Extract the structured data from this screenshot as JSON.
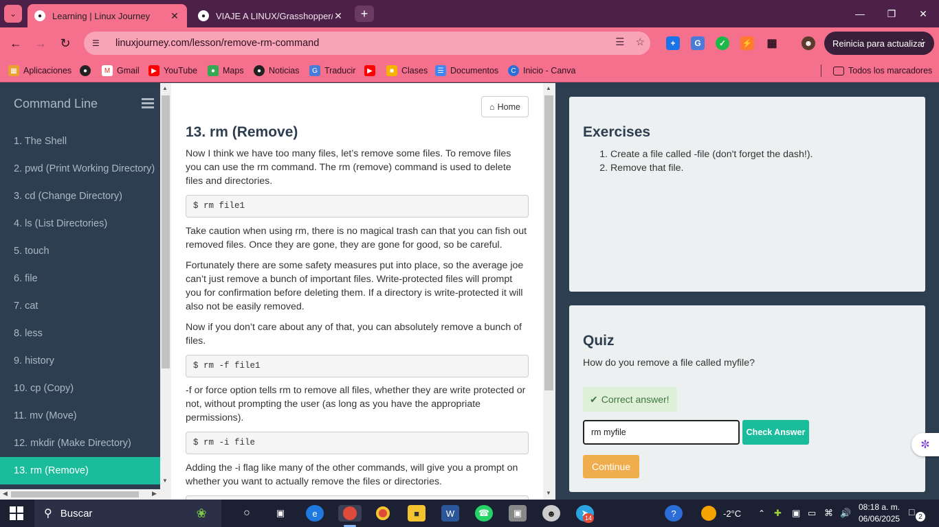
{
  "browser": {
    "tabs": [
      {
        "title": "Learning | Linux Journey",
        "active": true,
        "icon": "penguin-icon"
      },
      {
        "title": "VIAJE A LINUX/Grasshopper/Linux",
        "active": false,
        "icon": "github-icon"
      }
    ],
    "url": "linuxjourney.com/lesson/remove-rm-command",
    "update_button": "Reinicia para actualizar",
    "bookmarks": [
      {
        "label": "Aplicaciones",
        "icon": "apps-grid-icon"
      },
      {
        "label": "",
        "icon": "globe-icon"
      },
      {
        "label": "Gmail",
        "icon": "gmail-icon"
      },
      {
        "label": "YouTube",
        "icon": "youtube-icon"
      },
      {
        "label": "Maps",
        "icon": "maps-icon"
      },
      {
        "label": "Noticias",
        "icon": "news-icon"
      },
      {
        "label": "Traducir",
        "icon": "translate-icon"
      },
      {
        "label": "",
        "icon": "youtube-icon"
      },
      {
        "label": "Clases",
        "icon": "classroom-icon"
      },
      {
        "label": "Documentos",
        "icon": "docs-icon"
      },
      {
        "label": "Inicio - Canva",
        "icon": "canva-icon"
      }
    ],
    "all_bookmarks": "Todos los marcadores",
    "colors": {
      "tabbar": "#4c2048",
      "toolbar": "#f4708c"
    }
  },
  "sidebar": {
    "title": "Command Line",
    "items": [
      "1. The Shell",
      "2. pwd (Print Working Directory)",
      "3. cd (Change Directory)",
      "4. ls (List Directories)",
      "5. touch",
      "6. file",
      "7. cat",
      "8. less",
      "9. history",
      "10. cp (Copy)",
      "11. mv (Move)",
      "12. mkdir (Make Directory)",
      "13. rm (Remove)"
    ],
    "active_index": 12,
    "colors": {
      "background": "#2c3e50",
      "active": "#1abc9c"
    }
  },
  "lesson": {
    "home_button": "Home",
    "title": "13. rm (Remove)",
    "p1": "Now I think we have too many files, let’s remove some files. To remove files you can use the rm command. The rm (remove) command is used to delete files and directories.",
    "code1": "$ rm file1",
    "p2": "Take caution when using rm, there is no magical trash can that you can fish out removed files. Once they are gone, they are gone for good, so be careful.",
    "p3": "Fortunately there are some safety measures put into place, so the average joe can’t just remove a bunch of important files. Write-protected files will prompt you for confirmation before deleting them. If a directory is write-protected it will also not be easily removed.",
    "p4": "Now if you don’t care about any of that, you can absolutely remove a bunch of files.",
    "code2": "$ rm -f file1",
    "p5": "-f or force option tells rm to remove all files, whether they are write protected or not, without prompting the user (as long as you have the appropriate permissions).",
    "code3": "$ rm -i file",
    "p6": "Adding the -i flag like many of the other commands, will give you a prompt on whether you want to actually remove the files or directories."
  },
  "exercises": {
    "title": "Exercises",
    "items": [
      "Create a file called -file (don't forget the dash!).",
      "Remove that file."
    ]
  },
  "quiz": {
    "title": "Quiz",
    "question": "How do you remove a file called myfile?",
    "status": "Correct answer!",
    "answer_value": "rm myfile",
    "check_button": "Check Answer",
    "continue_button": "Continue",
    "colors": {
      "success_bg": "#dff0d8",
      "check": "#1abc9c",
      "continue": "#f0ad4e"
    }
  },
  "taskbar": {
    "search_placeholder": "Buscar",
    "weather": "-2°C",
    "time": "08:18 a. m.",
    "date": "06/06/2025",
    "telegram_badge": "14",
    "notifications": "2"
  }
}
